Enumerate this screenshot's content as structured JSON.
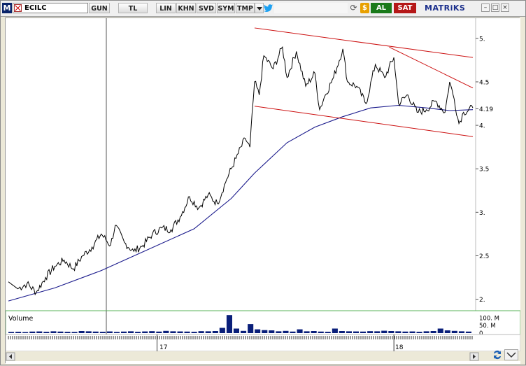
{
  "toolbar": {
    "logo": "M",
    "symbol": "ECILC",
    "buttons": [
      "GUN",
      "TL",
      "LIN",
      "KHN",
      "SVD",
      "SYM",
      "TMP"
    ],
    "buy_label": "AL",
    "sell_label": "SAT",
    "brand": "MATRiKS",
    "colors": {
      "buy": "#1a7a1a",
      "sell": "#b51818",
      "brand": "#1b2f8c"
    },
    "icons": [
      "close-check-icon",
      "dropdown-arrow-icon",
      "twitter-icon",
      "refresh-icon",
      "dollar-icon",
      "minimize-icon",
      "maximize-icon",
      "close-icon"
    ]
  },
  "chart": {
    "price_axis_labels": [
      "5.",
      "4.5",
      "4.19",
      "4.",
      "3.5",
      "3.",
      "2.5",
      "2."
    ],
    "current_price": "4.19",
    "volume_title": "Volume",
    "volume_axis_labels": [
      "100. M",
      "50. M",
      "0"
    ],
    "date_labels": [
      "17",
      "18"
    ],
    "colors": {
      "price": "#000000",
      "moving_average": "#1a1a8c",
      "channel": "#cc1111",
      "volume": "#0a1f7a",
      "panel_border": "#58b358"
    }
  },
  "chart_data": {
    "type": "line",
    "ylim": [
      1.9,
      5.2
    ],
    "x_labels": [
      "17",
      "18"
    ],
    "series": [],
    "price_path": [
      [
        0,
        2.2
      ],
      [
        2,
        2.12
      ],
      [
        4,
        2.18
      ],
      [
        6,
        2.08
      ],
      [
        8,
        2.25
      ],
      [
        10,
        2.38
      ],
      [
        12,
        2.45
      ],
      [
        14,
        2.35
      ],
      [
        16,
        2.5
      ],
      [
        18,
        2.6
      ],
      [
        20,
        2.75
      ],
      [
        22,
        2.62
      ],
      [
        23,
        2.85
      ],
      [
        25,
        2.65
      ],
      [
        27,
        2.55
      ],
      [
        29,
        2.62
      ],
      [
        31,
        2.75
      ],
      [
        33,
        2.82
      ],
      [
        35,
        2.8
      ],
      [
        37,
        2.95
      ],
      [
        39,
        3.18
      ],
      [
        41,
        3.05
      ],
      [
        43,
        3.2
      ],
      [
        45,
        3.1
      ],
      [
        47,
        3.38
      ],
      [
        49,
        3.62
      ],
      [
        51,
        3.85
      ],
      [
        52,
        3.75
      ],
      [
        53,
        4.5
      ],
      [
        54,
        4.35
      ],
      [
        55,
        4.8
      ],
      [
        57,
        4.65
      ],
      [
        59,
        4.9
      ],
      [
        60,
        4.55
      ],
      [
        62,
        4.85
      ],
      [
        64,
        4.45
      ],
      [
        66,
        4.6
      ],
      [
        67,
        4.18
      ],
      [
        68,
        4.32
      ],
      [
        70,
        4.55
      ],
      [
        72,
        4.88
      ],
      [
        73,
        4.5
      ],
      [
        75,
        4.45
      ],
      [
        77,
        4.25
      ],
      [
        79,
        4.7
      ],
      [
        81,
        4.55
      ],
      [
        83,
        4.78
      ],
      [
        84,
        4.25
      ],
      [
        86,
        4.35
      ],
      [
        88,
        4.15
      ],
      [
        90,
        4.18
      ],
      [
        92,
        4.28
      ],
      [
        94,
        4.15
      ],
      [
        95,
        4.5
      ],
      [
        96,
        4.3
      ],
      [
        97,
        4.02
      ],
      [
        98,
        4.15
      ],
      [
        100,
        4.2
      ]
    ],
    "ma_path": [
      [
        0,
        1.98
      ],
      [
        10,
        2.13
      ],
      [
        20,
        2.33
      ],
      [
        30,
        2.57
      ],
      [
        40,
        2.81
      ],
      [
        48,
        3.16
      ],
      [
        53,
        3.45
      ],
      [
        60,
        3.8
      ],
      [
        66,
        3.98
      ],
      [
        72,
        4.1
      ],
      [
        78,
        4.2
      ],
      [
        84,
        4.23
      ],
      [
        90,
        4.2
      ],
      [
        95,
        4.17
      ],
      [
        100,
        4.18
      ]
    ],
    "channel_upper": [
      [
        53,
        5.12
      ],
      [
        100,
        4.78
      ]
    ],
    "channel_lower": [
      [
        53,
        4.22
      ],
      [
        100,
        3.87
      ]
    ],
    "resistance": [
      [
        82,
        4.9
      ],
      [
        100,
        4.43
      ]
    ],
    "volume_series": [
      8,
      9,
      7,
      10,
      11,
      9,
      12,
      10,
      9,
      8,
      14,
      12,
      10,
      9,
      11,
      8,
      10,
      12,
      9,
      11,
      13,
      10,
      15,
      12,
      11,
      10,
      9,
      13,
      12,
      14,
      35,
      120,
      30,
      15,
      60,
      25,
      20,
      18,
      12,
      15,
      10,
      25,
      12,
      14,
      10,
      9,
      30,
      14,
      12,
      11,
      10,
      13,
      12,
      16,
      14,
      12,
      10,
      11,
      9,
      12,
      14,
      30,
      18,
      15,
      12,
      10
    ]
  }
}
